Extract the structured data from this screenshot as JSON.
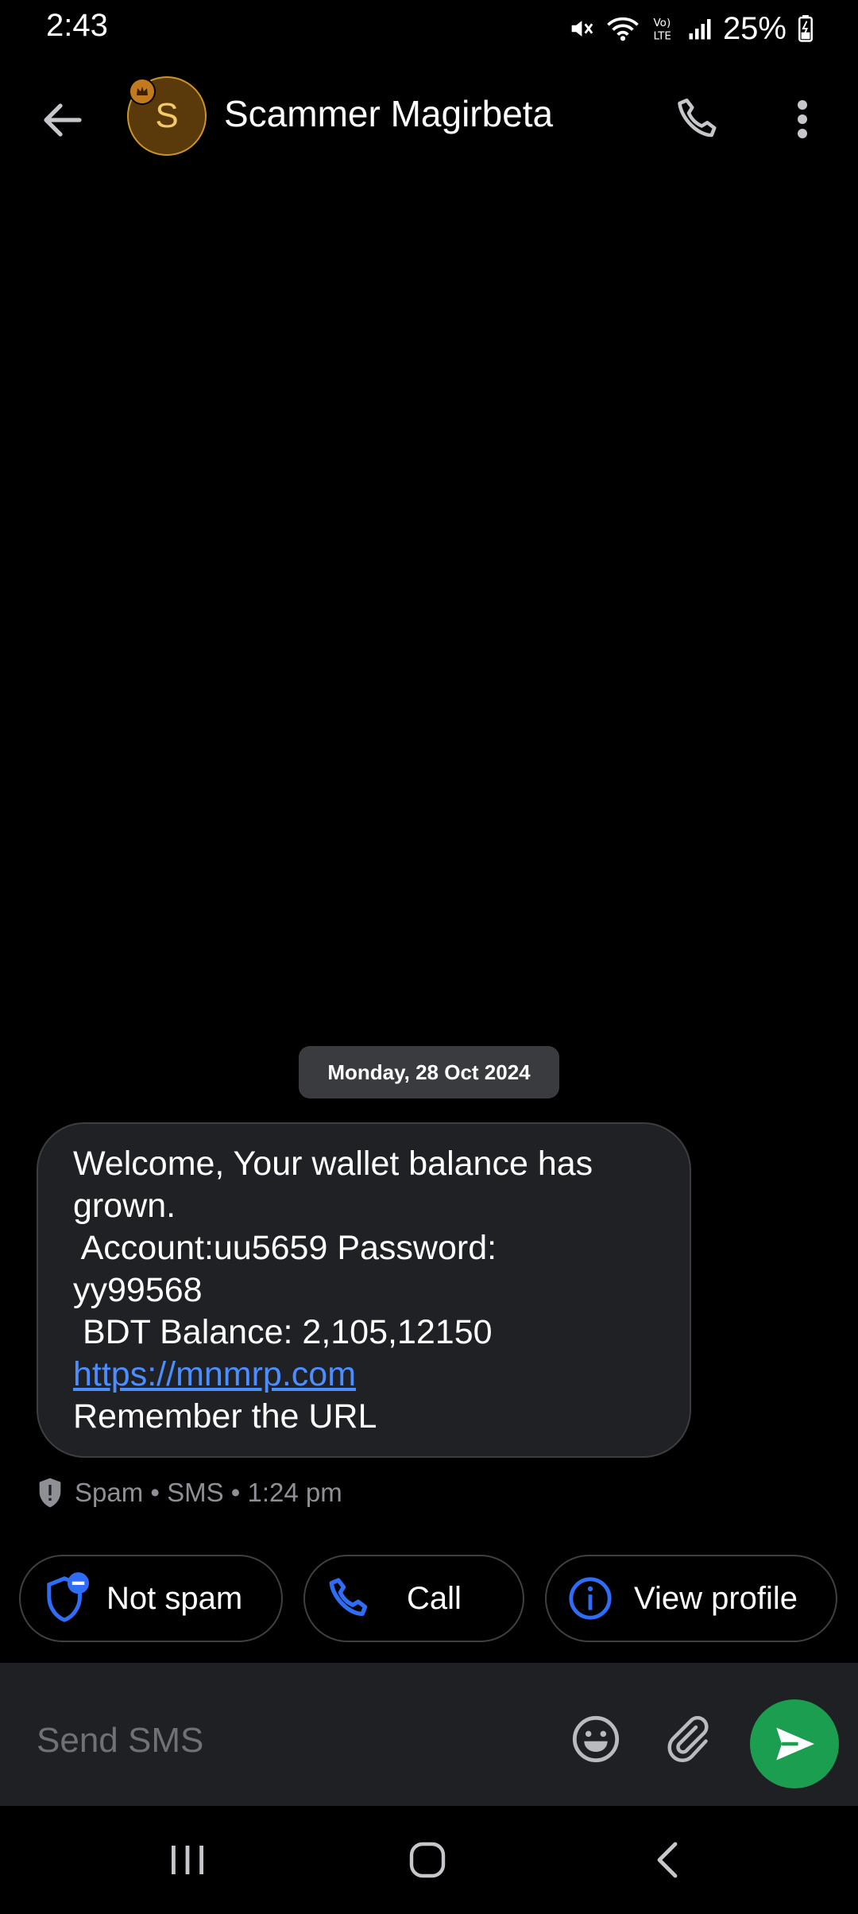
{
  "status_bar": {
    "time": "2:43",
    "battery": "25%",
    "icons": [
      "mute-icon",
      "wifi-icon",
      "volte-icon",
      "signal-icon",
      "battery-icon"
    ]
  },
  "header": {
    "avatar_letter": "S",
    "contact_name": "Scammer Magirbeta",
    "icons": [
      "back-arrow-icon",
      "crown-icon",
      "phone-icon",
      "more-vert-icon"
    ]
  },
  "conversation": {
    "date": "Monday, 28 Oct 2024",
    "message": {
      "lines": [
        "Welcome, Your wallet balance has",
        "grown.",
        " Account:uu5659 Password:",
        "yy99568",
        " BDT Balance: 2,105,12150"
      ],
      "link": "https://mnmrp.com",
      "last_line": "Remember the URL"
    },
    "meta": "Spam • SMS • 1:24 pm"
  },
  "actions": {
    "not_spam": "Not spam",
    "call": "Call",
    "view_profile": "View profile"
  },
  "composer": {
    "placeholder": "Send SMS"
  },
  "colors": {
    "background": "#000000",
    "bubble": "#202124",
    "link": "#4c8dff",
    "accent_blue": "#2f6df6",
    "send": "#1b9e4f",
    "avatar": "#5a3a0a"
  }
}
